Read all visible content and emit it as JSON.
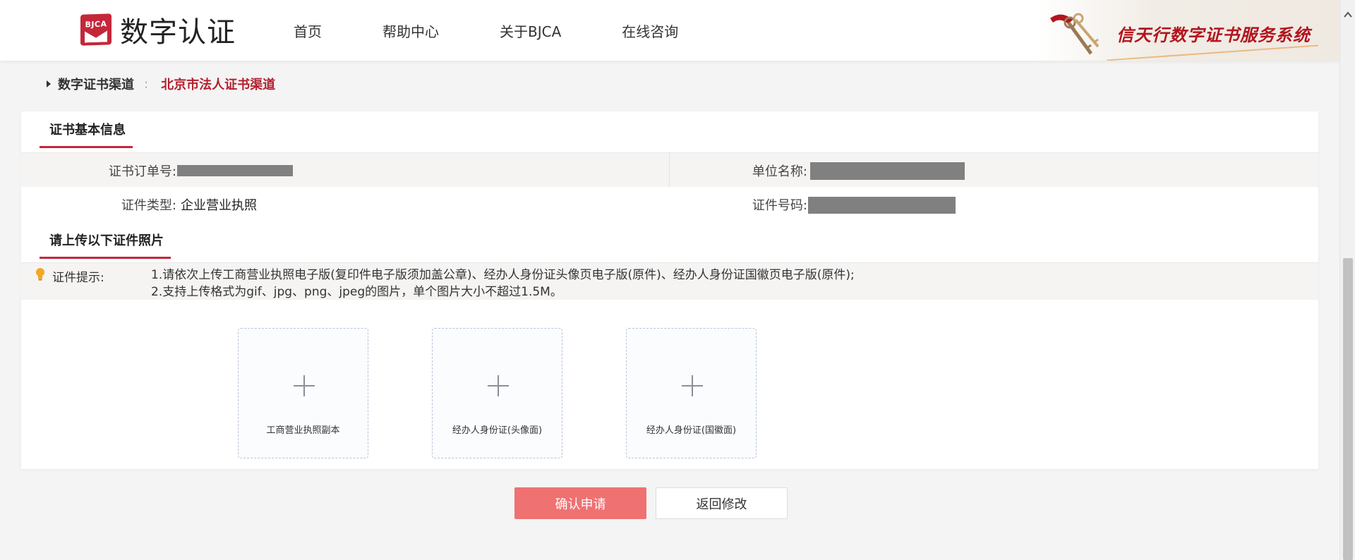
{
  "header": {
    "logo_badge": "BJCA",
    "logo_text": "数字认证",
    "nav": [
      "首页",
      "帮助中心",
      "关于BJCA",
      "在线咨询"
    ],
    "banner_text": "信天行数字证书服务系统"
  },
  "breadcrumb": {
    "root": "数字证书渠道",
    "separator": ":",
    "current": "北京市法人证书渠道"
  },
  "basic_info": {
    "title": "证书基本信息",
    "order_label": "证书订单号:",
    "org_label": "单位名称:",
    "cert_type_label": "证件类型:",
    "cert_type_value": "企业营业执照",
    "cert_no_label": "证件号码:"
  },
  "upload_section": {
    "title": "请上传以下证件照片",
    "tip_label": "证件提示:",
    "tip_lines": [
      "1.请依次上传工商营业执照电子版(复印件电子版须加盖公章)、经办人身份证头像页电子版(原件)、经办人身份证国徽页电子版(原件);",
      "2.支持上传格式为gif、jpg、png、jpeg的图片，单个图片大小不超过1.5M。"
    ],
    "boxes": [
      {
        "label": "工商营业执照副本"
      },
      {
        "label": "经办人身份证(头像面)"
      },
      {
        "label": "经办人身份证(国徽面)"
      }
    ]
  },
  "actions": {
    "confirm": "确认申请",
    "back": "返回修改"
  },
  "colors": {
    "accent": "#c4273a",
    "primary_button": "#f07171",
    "breadcrumb_current": "#b3202e",
    "redacted": "#808080"
  }
}
